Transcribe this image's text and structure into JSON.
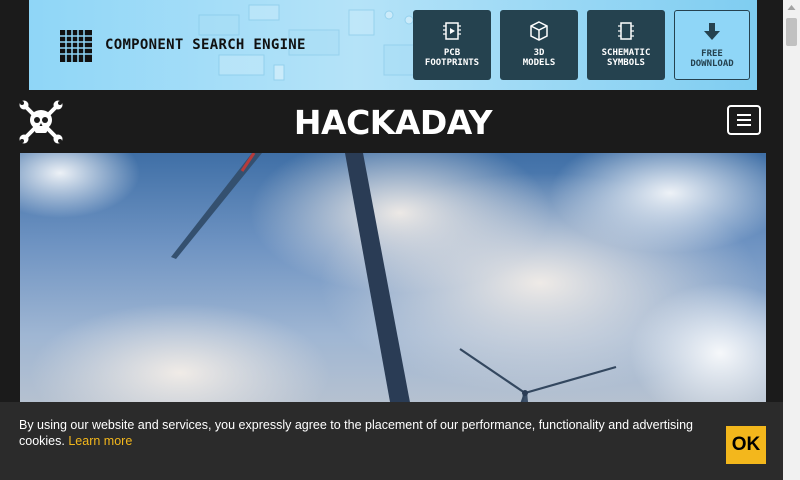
{
  "ad": {
    "title": "COMPONENT SEARCH ENGINE",
    "buttons": [
      {
        "line1": "PCB",
        "line2": "FOOTPRINTS",
        "icon": "chip-icon"
      },
      {
        "line1": "3D",
        "line2": "MODELS",
        "icon": "cube-icon"
      },
      {
        "line1": "SCHEMATIC",
        "line2": "SYMBOLS",
        "icon": "schematic-icon"
      },
      {
        "line1": "FREE",
        "line2": "DOWNLOAD",
        "icon": "download-arrow-icon"
      }
    ]
  },
  "header": {
    "title": "HACKADAY",
    "logo_icon": "skull-wrenches-icon",
    "menu_icon": "hamburger-menu-icon"
  },
  "hero": {
    "image": "wind-turbines-photo"
  },
  "cookie": {
    "text": "By using our website and services, you expressly agree to the placement of our performance, functionality and advertising cookies.",
    "link_label": "Learn more",
    "ok_label": "OK"
  },
  "colors": {
    "accent": "#f3b71c",
    "header_bg": "#1b1b1b",
    "cookie_bg": "#2b2b2b",
    "ad_bg": "#8fd6f7",
    "ad_button": "#25424f"
  }
}
